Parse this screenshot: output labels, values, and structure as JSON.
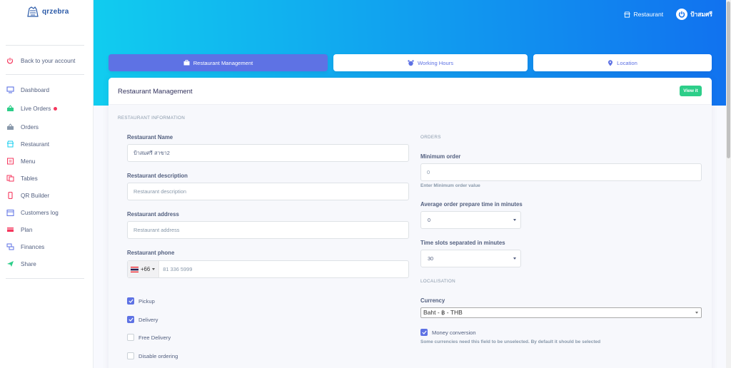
{
  "brand": {
    "name": "qrzebra"
  },
  "sidebar": {
    "back": "Back to your account",
    "items": [
      {
        "label": "Dashboard",
        "icon": "monitor-icon",
        "color": "#5e72e4"
      },
      {
        "label": "Live Orders",
        "icon": "basket-icon",
        "color": "#2dce89",
        "badge": true
      },
      {
        "label": "Orders",
        "icon": "basket-icon",
        "color": "#8898aa"
      },
      {
        "label": "Restaurant",
        "icon": "shop-icon",
        "color": "#11cdef"
      },
      {
        "label": "Menu",
        "icon": "book-icon",
        "color": "#f5365c"
      },
      {
        "label": "Tables",
        "icon": "tables-icon",
        "color": "#f5365c"
      },
      {
        "label": "QR Builder",
        "icon": "mobile-icon",
        "color": "#f5365c"
      },
      {
        "label": "Customers log",
        "icon": "calendar-icon",
        "color": "#5e72e4"
      },
      {
        "label": "Plan",
        "icon": "credit-card-icon",
        "color": "#f5365c"
      },
      {
        "label": "Finances",
        "icon": "money-icon",
        "color": "#5e72e4"
      },
      {
        "label": "Share",
        "icon": "send-icon",
        "color": "#2dce89"
      }
    ]
  },
  "header": {
    "restaurant_link": "Restaurant",
    "user_name": "ป้าสมศรี"
  },
  "tabs": [
    {
      "label": "Restaurant Management",
      "icon": "briefcase-icon",
      "active": true
    },
    {
      "label": "Working Hours",
      "icon": "alarm-icon",
      "active": false
    },
    {
      "label": "Location",
      "icon": "pin-icon",
      "active": false
    }
  ],
  "card": {
    "title": "Restaurant Management",
    "view_button": "View it"
  },
  "info": {
    "section": "RESTAURANT INFORMATION",
    "name_label": "Restaurant Name",
    "name_value": "ป้าสมศรี สาขา2",
    "desc_label": "Restaurant description",
    "desc_placeholder": "Restaurant description",
    "address_label": "Restaurant address",
    "address_placeholder": "Restaurant address",
    "phone_label": "Restaurant phone",
    "phone_code": "+66",
    "phone_placeholder": "81 336 5999",
    "checkboxes": [
      {
        "label": "Pickup",
        "checked": true
      },
      {
        "label": "Delivery",
        "checked": true
      },
      {
        "label": "Free Delivery",
        "checked": false
      },
      {
        "label": "Disable ordering",
        "checked": false
      }
    ]
  },
  "orders": {
    "section": "ORDERS",
    "min_label": "Minimum order",
    "min_value": "0",
    "min_hint": "Enter Minimum order value",
    "avg_label": "Average order prepare time in minutes",
    "avg_value": "0",
    "slots_label": "Time slots separated in minutes",
    "slots_value": "30"
  },
  "localisation": {
    "section": "LOCALISATION",
    "currency_label": "Currency",
    "currency_value": "Baht - ฿ - THB",
    "money_conversion_label": "Money conversion",
    "money_conversion_checked": true,
    "money_conversion_hint": "Some currencies need this field to be unselected. By default it should be selected"
  },
  "colors": {
    "primary": "#5e72e4",
    "success": "#2dce89",
    "gradient_start": "#11cdef",
    "gradient_end": "#1171ef"
  }
}
